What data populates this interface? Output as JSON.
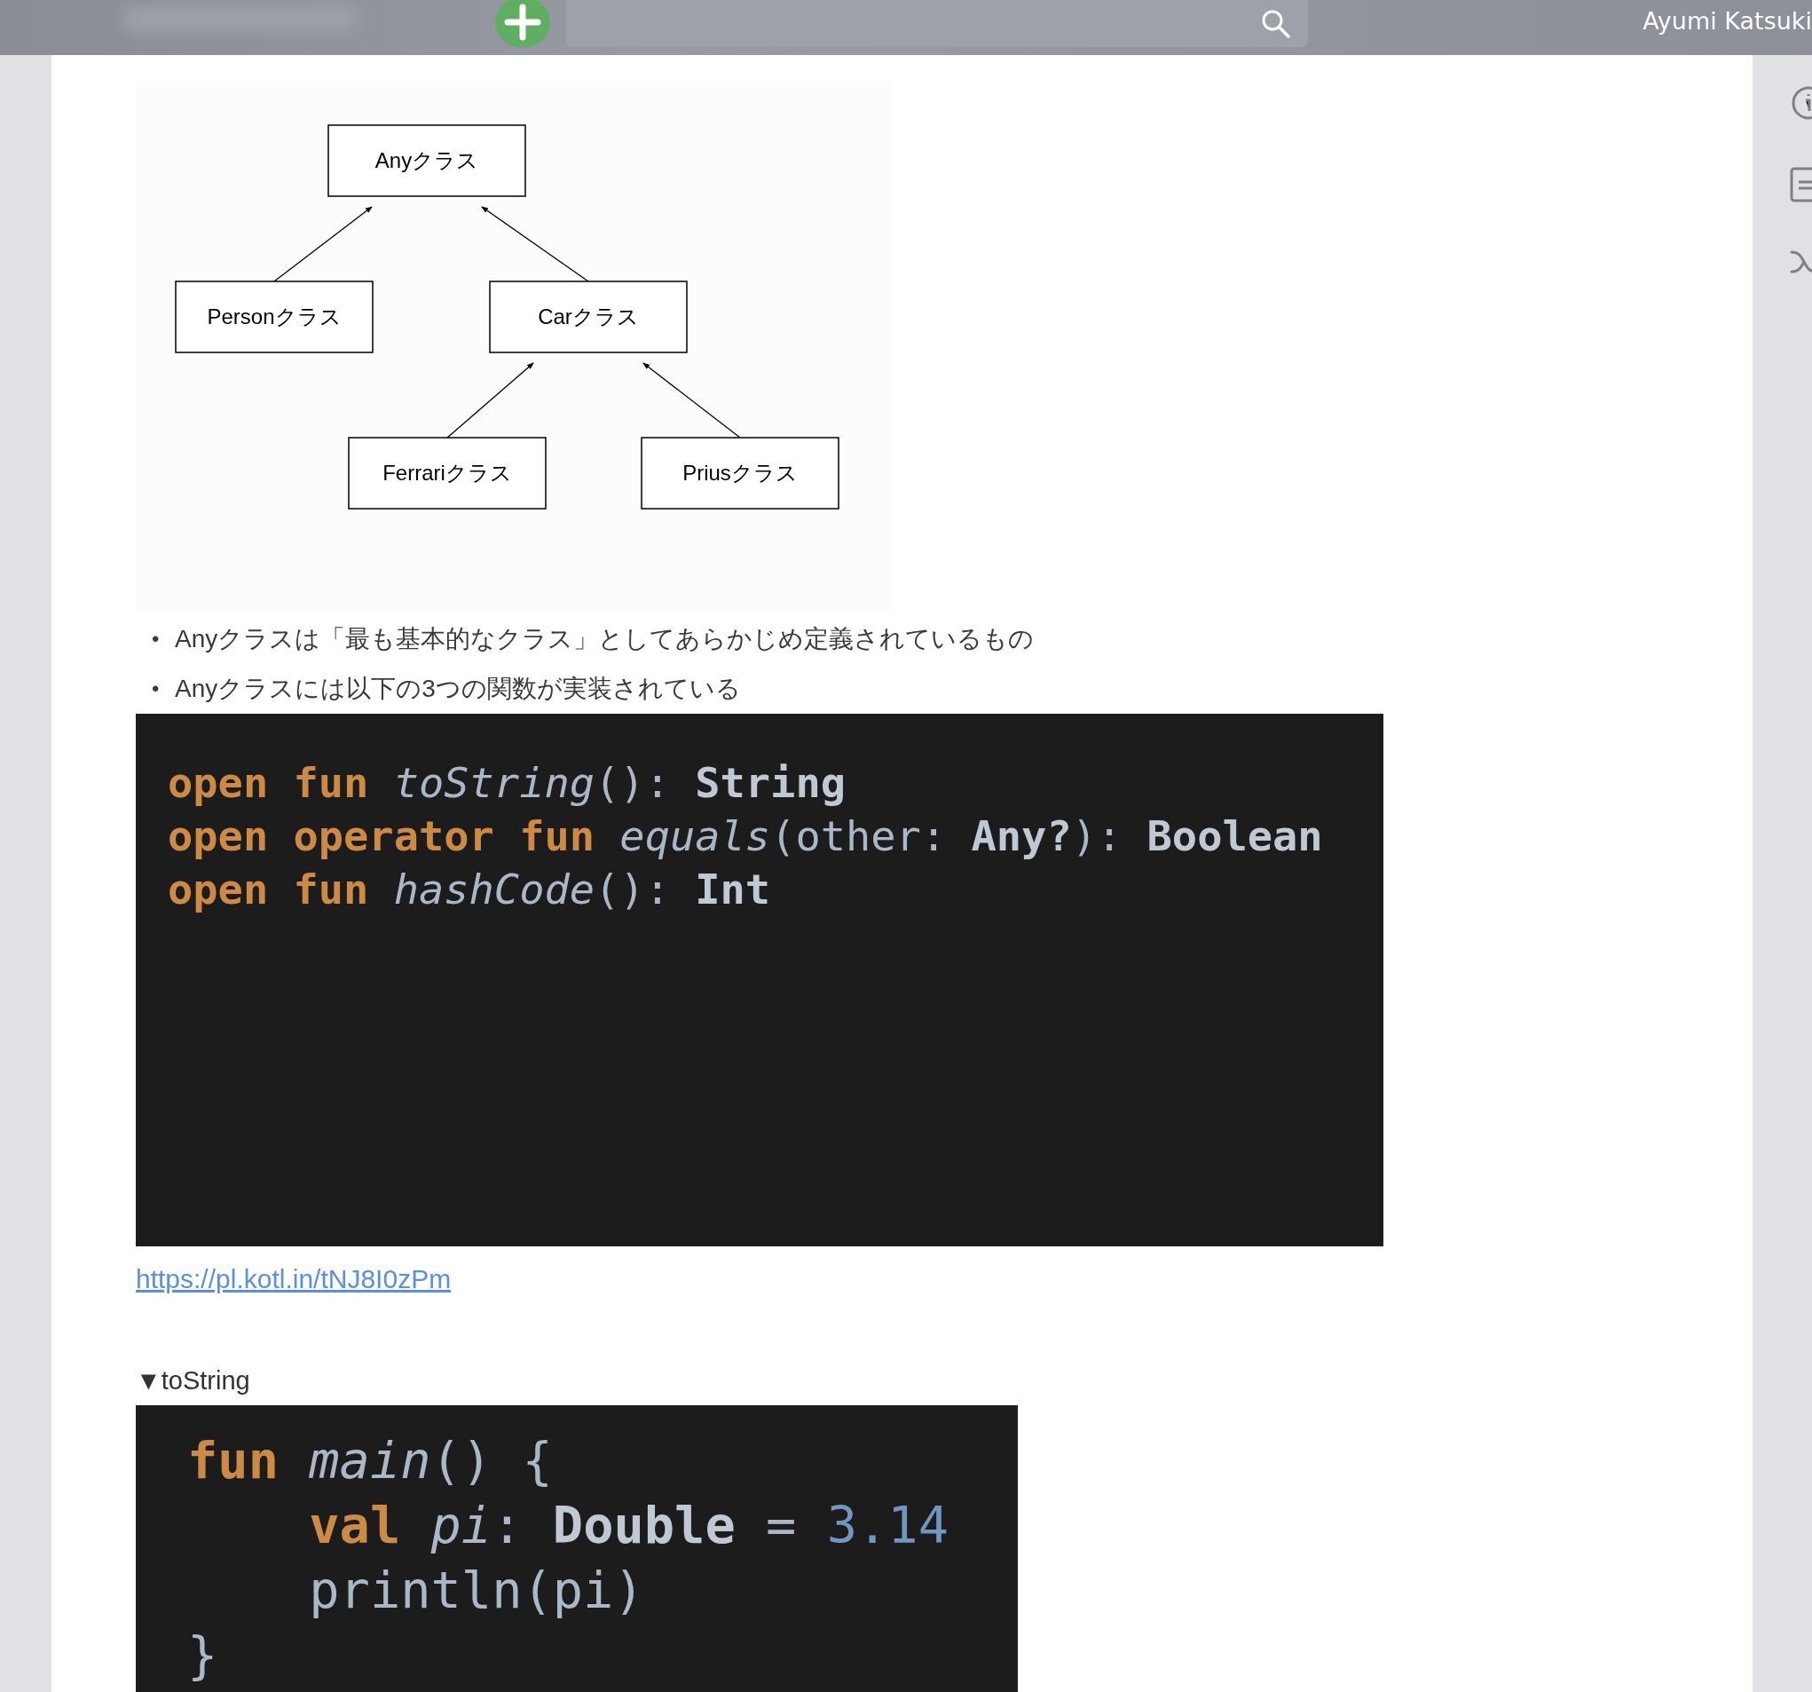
{
  "top_bar": {
    "user_name": "Ayumi Katsuki"
  },
  "diagram": {
    "root": {
      "label": "Anyクラス",
      "children": [
        {
          "label": "Personクラス"
        },
        {
          "label": "Carクラス",
          "children": [
            {
              "label": "Ferrariクラス"
            },
            {
              "label": "Priusクラス"
            }
          ]
        }
      ]
    }
  },
  "bullets": [
    {
      "marker": "•",
      "text": "Anyクラスは「最も基本的なクラス」としてあらかじめ定義されているもの"
    },
    {
      "marker": "•",
      "text": "Anyクラスには以下の3つの関数が実装されている"
    }
  ],
  "code_block": {
    "lines": [
      [
        {
          "kind": "keyword",
          "text": "open "
        },
        {
          "kind": "keyword",
          "text": "fun "
        },
        {
          "kind": "function",
          "text": "toString"
        },
        {
          "kind": "plain",
          "text": "(): "
        },
        {
          "kind": "type",
          "text": "String"
        }
      ],
      [
        {
          "kind": "keyword",
          "text": "open "
        },
        {
          "kind": "keyword",
          "text": "operator "
        },
        {
          "kind": "keyword",
          "text": "fun "
        },
        {
          "kind": "function",
          "text": "equals"
        },
        {
          "kind": "plain",
          "text": "(other: "
        },
        {
          "kind": "type",
          "text": "Any?"
        },
        {
          "kind": "plain",
          "text": "): "
        },
        {
          "kind": "type",
          "text": "Boolean"
        }
      ],
      [
        {
          "kind": "keyword",
          "text": "open "
        },
        {
          "kind": "keyword",
          "text": "fun "
        },
        {
          "kind": "function",
          "text": "hashCode"
        },
        {
          "kind": "plain",
          "text": "(): "
        },
        {
          "kind": "type",
          "text": "Int"
        }
      ]
    ]
  },
  "link": "https://pl.kotl.in/tNJ8I0zPm",
  "details": {
    "marker": "▼",
    "summary": "toString",
    "expanded": true,
    "code_block": {
      "lines": [
        [
          {
            "kind": "keyword",
            "text": "fun "
          },
          {
            "kind": "function",
            "text": "main"
          },
          {
            "kind": "plain",
            "text": "() {"
          }
        ],
        [
          {
            "kind": "keyword",
            "text": "    val "
          },
          {
            "kind": "function",
            "text": "pi"
          },
          {
            "kind": "plain",
            "text": ": "
          },
          {
            "kind": "type",
            "text": "Double"
          },
          {
            "kind": "plain",
            "text": " = "
          },
          {
            "kind": "number",
            "text": "3.14"
          }
        ],
        [
          {
            "kind": "plain",
            "text": "    println(pi)"
          }
        ],
        [
          {
            "kind": "plain",
            "text": "}"
          }
        ]
      ]
    }
  }
}
